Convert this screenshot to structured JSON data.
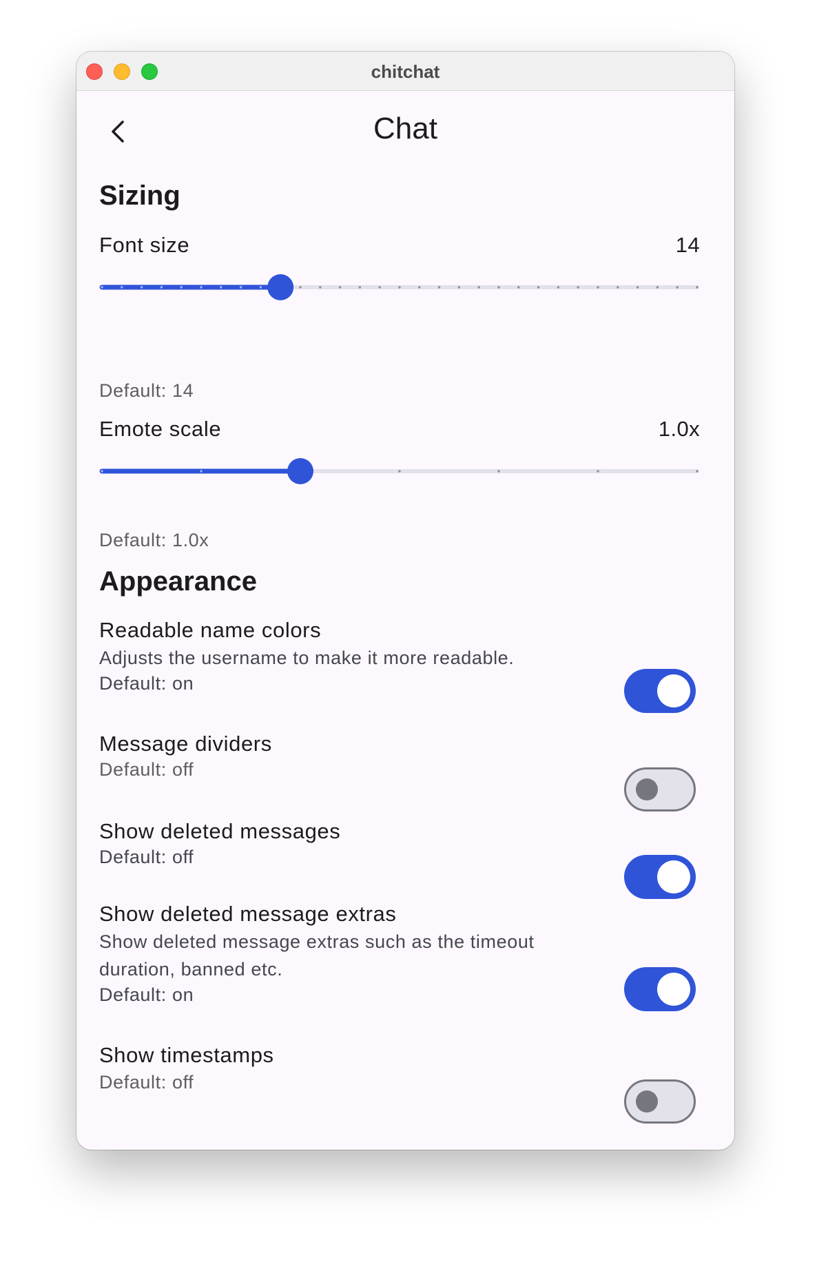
{
  "window": {
    "title": "chitchat"
  },
  "header": {
    "title": "Chat",
    "back_icon": "chevron-left-icon"
  },
  "colors": {
    "accent": "#2f54d8",
    "track_inactive": "#e3e1ea",
    "toggle_off": "#76767f"
  },
  "sizing": {
    "title": "Sizing",
    "font_size": {
      "label": "Font size",
      "value": "14",
      "default": "Default: 14",
      "steps": 30,
      "position": 9
    },
    "emote_scale": {
      "label": "Emote scale",
      "value": "1.0x",
      "default": "Default: 1.0x",
      "steps": 6,
      "position": 2
    }
  },
  "appearance": {
    "title": "Appearance",
    "items": [
      {
        "label": "Readable name colors",
        "description": "Adjusts the username to make it more readable.",
        "default": "Default: on",
        "enabled": true
      },
      {
        "label": "Message dividers",
        "default": "Default: off",
        "enabled": false
      },
      {
        "label": "Show deleted messages",
        "default": "Default: off",
        "enabled": true
      },
      {
        "label": "Show deleted message extras",
        "description_line1": "Show deleted message extras such as the timeout",
        "description_line2": "duration, banned etc.",
        "default": "Default: on",
        "enabled": true
      },
      {
        "label": "Show timestamps",
        "default": "Default: off",
        "enabled": false
      }
    ]
  }
}
